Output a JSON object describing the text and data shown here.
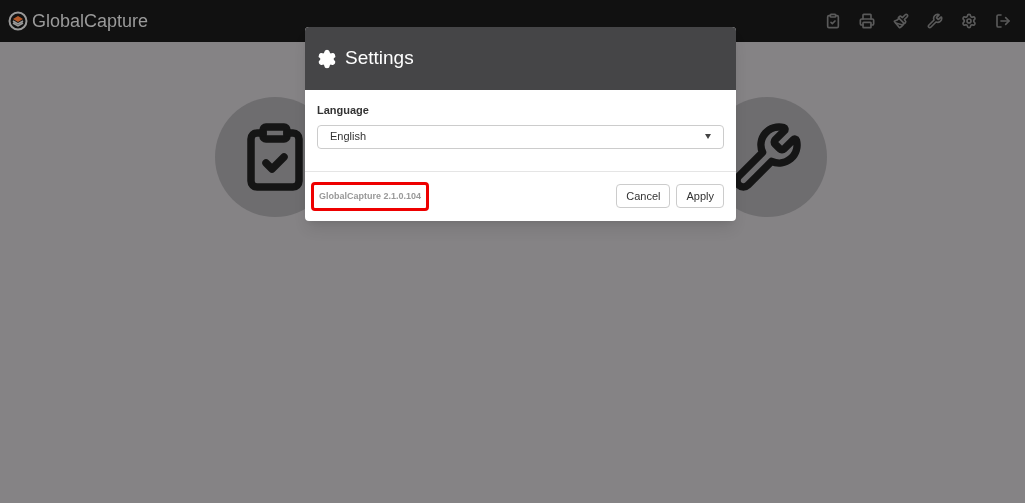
{
  "app_bar": {
    "title": "GlobalCapture"
  },
  "dialog": {
    "title": "Settings",
    "field_label": "Language",
    "select_value": "English",
    "version": "GlobalCapture 2.1.0.104",
    "version_highlighted": true,
    "buttons": [
      "Cancel",
      "Apply"
    ]
  }
}
